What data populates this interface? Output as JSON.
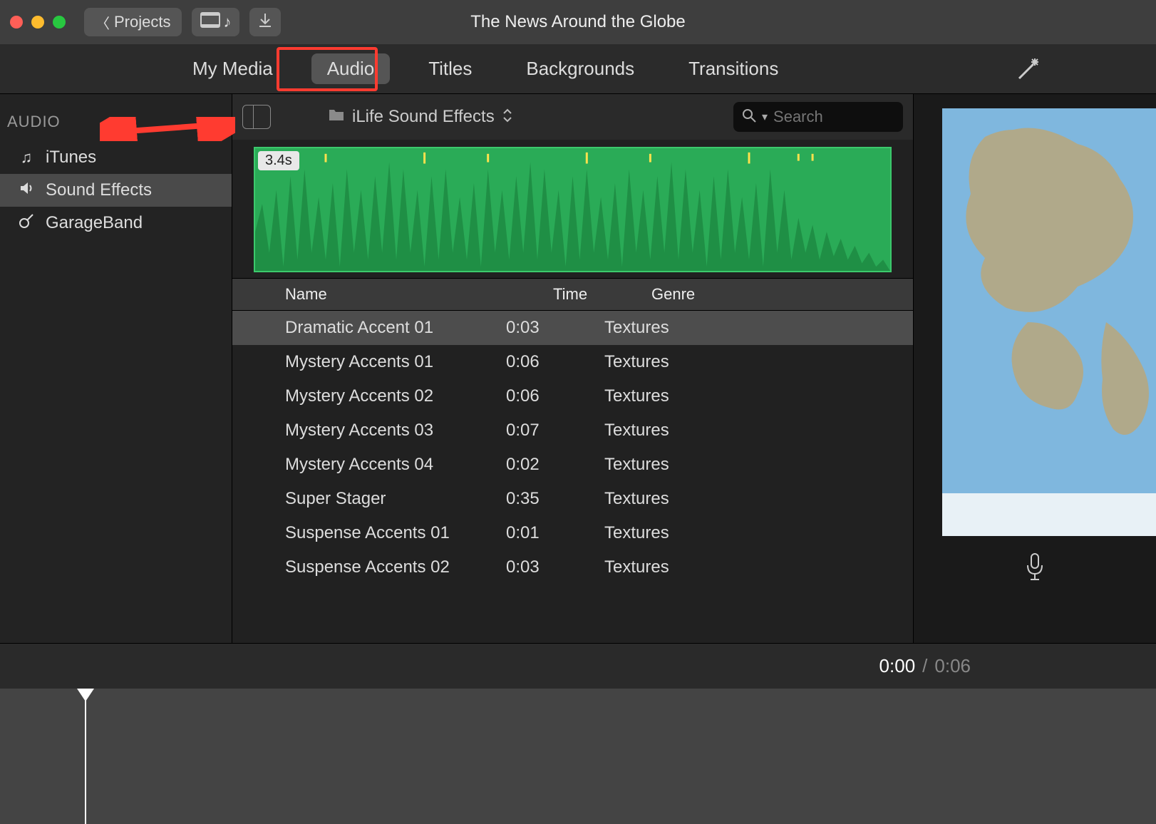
{
  "window": {
    "title": "The News Around the Globe"
  },
  "titlebar": {
    "back_label": "Projects"
  },
  "tabs": {
    "items": [
      "My Media",
      "Audio",
      "Titles",
      "Backgrounds",
      "Transitions"
    ],
    "active_index": 1
  },
  "sidebar": {
    "header": "AUDIO",
    "items": [
      {
        "label": "iTunes",
        "icon": "music-note-icon"
      },
      {
        "label": "Sound Effects",
        "icon": "speaker-icon"
      },
      {
        "label": "GarageBand",
        "icon": "guitar-icon"
      }
    ],
    "selected_index": 1
  },
  "browser": {
    "breadcrumb": "iLife Sound Effects",
    "search_placeholder": "Search",
    "waveform_badge": "3.4s",
    "columns": [
      "Name",
      "Time",
      "Genre"
    ],
    "rows": [
      {
        "name": "Dramatic Accent 01",
        "time": "0:03",
        "genre": "Textures",
        "selected": true
      },
      {
        "name": "Mystery Accents 01",
        "time": "0:06",
        "genre": "Textures"
      },
      {
        "name": "Mystery Accents 02",
        "time": "0:06",
        "genre": "Textures"
      },
      {
        "name": "Mystery Accents 03",
        "time": "0:07",
        "genre": "Textures"
      },
      {
        "name": "Mystery Accents 04",
        "time": "0:02",
        "genre": "Textures"
      },
      {
        "name": "Super Stager",
        "time": "0:35",
        "genre": "Textures"
      },
      {
        "name": "Suspense Accents 01",
        "time": "0:01",
        "genre": "Textures"
      },
      {
        "name": "Suspense Accents 02",
        "time": "0:03",
        "genre": "Textures"
      }
    ]
  },
  "playback": {
    "current": "0:00",
    "total": "0:06"
  },
  "colors": {
    "accent_green": "#2aab57",
    "annotation_red": "#ff3b30"
  }
}
